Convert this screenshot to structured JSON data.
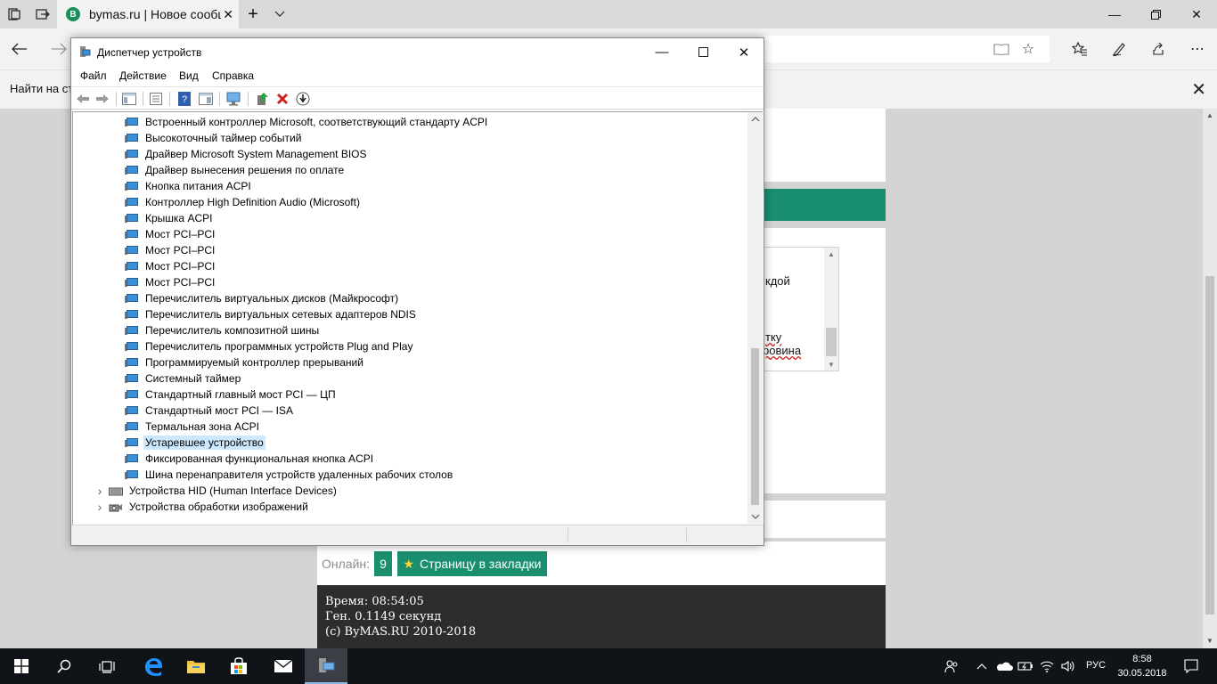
{
  "browser": {
    "tab_title": "bymas.ru | Новое сообщение",
    "tab_favicon_letter": "B",
    "find_label": "Найти на странице"
  },
  "website": {
    "textarea_fragments": [
      "кдой",
      "тку",
      "провина"
    ],
    "online_label": "Онлайн:",
    "online_count": "9",
    "bookmark_button": "Страницу в закладки",
    "footer_time": "Время: 08:54:05",
    "footer_gen": "Ген. 0.1149 секунд",
    "footer_copyright": "(c) ByMAS.RU 2010-2018"
  },
  "device_manager": {
    "title": "Диспетчер устройств",
    "menu": [
      "Файл",
      "Действие",
      "Вид",
      "Справка"
    ],
    "devices": [
      "Встроенный контроллер Microsoft, соответствующий стандарту ACPI",
      "Высокоточный таймер событий",
      "Драйвер Microsoft System Management BIOS",
      "Драйвер вынесения решения по оплате",
      "Кнопка питания ACPI",
      "Контроллер High Definition Audio (Microsoft)",
      "Крышка ACPI",
      "Мост PCI–PCI",
      "Мост PCI–PCI",
      "Мост PCI–PCI",
      "Мост PCI–PCI",
      "Перечислитель виртуальных дисков (Майкрософт)",
      "Перечислитель виртуальных сетевых адаптеров NDIS",
      "Перечислитель композитной шины",
      "Перечислитель программных устройств Plug and Play",
      "Программируемый контроллер прерываний",
      "Системный таймер",
      "Стандартный главный мост PCI — ЦП",
      "Стандартный мост PCI — ISA",
      "Термальная зона ACPI",
      "Устаревшее устройство",
      "Фиксированная функциональная кнопка ACPI",
      "Шина перенаправителя устройств удаленных рабочих столов"
    ],
    "selected_device": "Устаревшее устройство",
    "categories": [
      "Устройства HID (Human Interface Devices)",
      "Устройства обработки изображений"
    ]
  },
  "taskbar": {
    "language": "РУС",
    "time": "8:58",
    "date": "30.05.2018"
  }
}
